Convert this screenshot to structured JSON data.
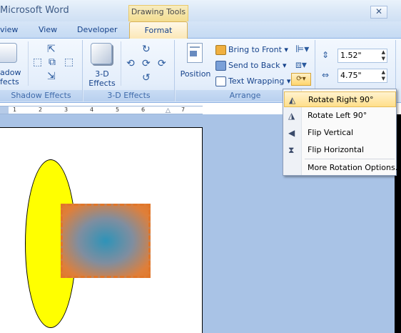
{
  "window": {
    "title": "Microsoft Word",
    "control_glyph": "✕"
  },
  "contextual_tab_group": "Drawing Tools",
  "tabs": [
    "view",
    "View",
    "Developer",
    "Format"
  ],
  "ribbon": {
    "groups": {
      "shadow": {
        "label": "Shadow Effects",
        "button_label_1": "adow",
        "button_label_2": "fects"
      },
      "threed": {
        "label": "3-D Effects",
        "button_label_1": "3-D",
        "button_label_2": "Effects"
      },
      "arrange": {
        "label": "Arrange",
        "position_label": "Position",
        "bring_to_front": "Bring to Front",
        "send_to_back": "Send to Back",
        "text_wrapping": "Text Wrapping"
      },
      "size": {
        "height_value": "1.52\"",
        "width_value": "4.75\""
      }
    }
  },
  "ruler": {
    "marks": [
      "1",
      "2",
      "3",
      "4",
      "5",
      "6",
      "7"
    ]
  },
  "rotate_menu": {
    "items": [
      {
        "label": "Rotate Right 90°",
        "icon": "rotate-right-icon"
      },
      {
        "label": "Rotate Left 90°",
        "icon": "rotate-left-icon"
      },
      {
        "label": "Flip Vertical",
        "icon": "flip-vertical-icon"
      },
      {
        "label": "Flip Horizontal",
        "icon": "flip-horizontal-icon"
      },
      {
        "label": "More Rotation Options...",
        "icon": ""
      }
    ]
  },
  "colors": {
    "ellipse_fill": "#ffff00",
    "rect_border": "#e0762a",
    "rect_center": "#2e93b8",
    "doc_background": "#a9c3e6"
  }
}
